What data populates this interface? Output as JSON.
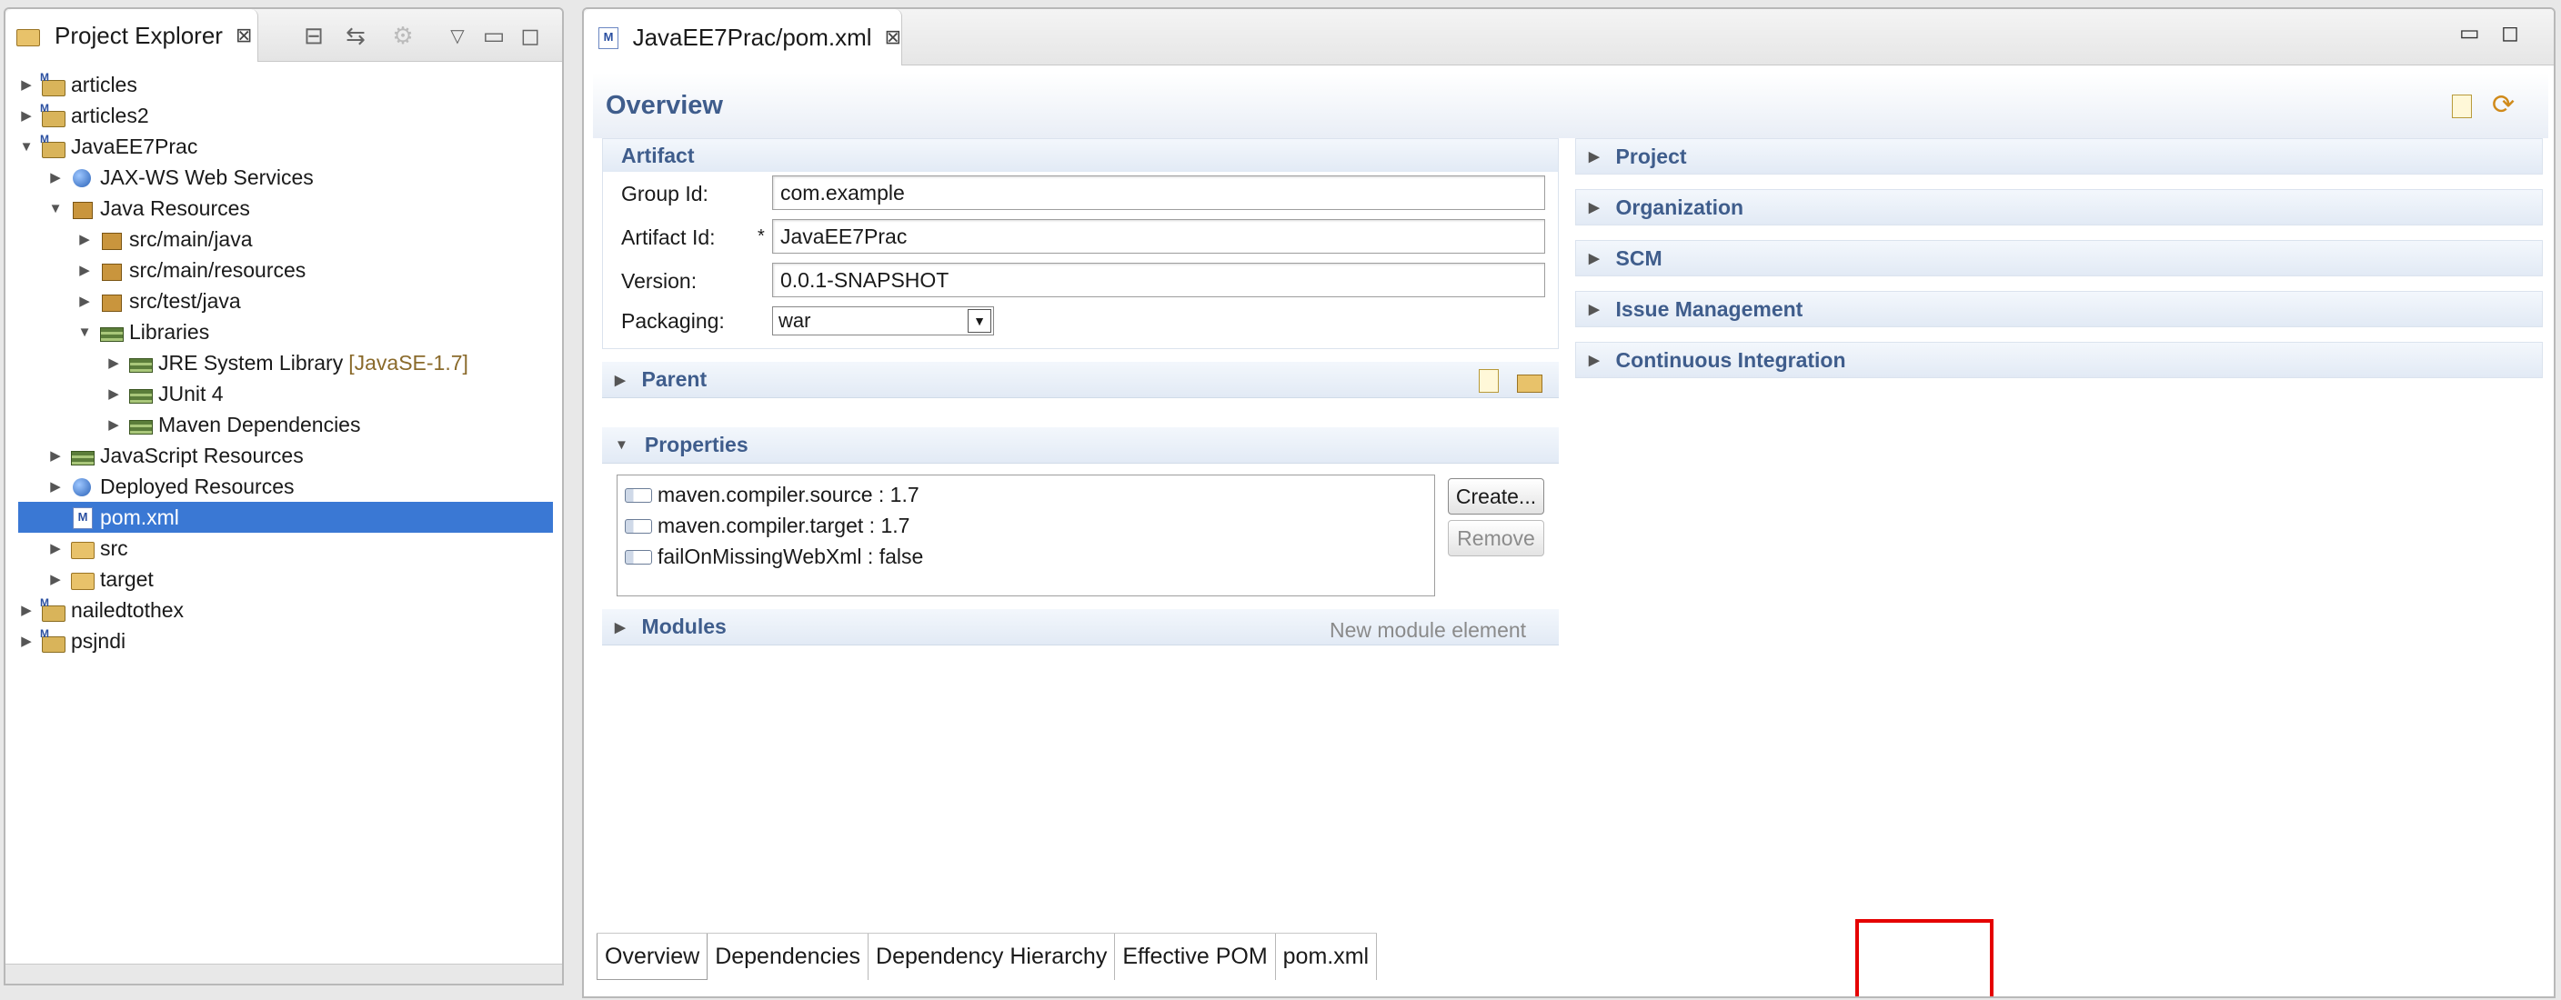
{
  "explorer": {
    "title": "Project Explorer",
    "close_glyph": "⊠",
    "tree": [
      {
        "label": "articles",
        "twisty": "▶",
        "icon": "proj",
        "indent": 0,
        "name": "tree-item-articles"
      },
      {
        "label": "articles2",
        "twisty": "▶",
        "icon": "proj",
        "indent": 0,
        "name": "tree-item-articles2"
      },
      {
        "label": "JavaEE7Prac",
        "twisty": "▼",
        "icon": "proj",
        "indent": 0,
        "name": "tree-item-javaee7prac"
      },
      {
        "label": "JAX-WS Web Services",
        "twisty": "▶",
        "icon": "globe",
        "indent": 1,
        "name": "tree-item-jaxws"
      },
      {
        "label": "Java Resources",
        "twisty": "▼",
        "icon": "pkg",
        "indent": 1,
        "name": "tree-item-java-resources"
      },
      {
        "label": "src/main/java",
        "twisty": "▶",
        "icon": "pkg",
        "indent": 2,
        "name": "tree-item-src-main-java"
      },
      {
        "label": "src/main/resources",
        "twisty": "▶",
        "icon": "pkg",
        "indent": 2,
        "name": "tree-item-src-main-resources"
      },
      {
        "label": "src/test/java",
        "twisty": "▶",
        "icon": "pkg",
        "indent": 2,
        "name": "tree-item-src-test-java"
      },
      {
        "label": "Libraries",
        "twisty": "▼",
        "icon": "lib",
        "indent": 2,
        "name": "tree-item-libraries"
      },
      {
        "label": "JRE System Library",
        "deco": "[JavaSE-1.7]",
        "twisty": "▶",
        "icon": "lib",
        "indent": 3,
        "name": "tree-item-jre"
      },
      {
        "label": "JUnit 4",
        "twisty": "▶",
        "icon": "lib",
        "indent": 3,
        "name": "tree-item-junit"
      },
      {
        "label": "Maven Dependencies",
        "twisty": "▶",
        "icon": "lib",
        "indent": 3,
        "name": "tree-item-maven-deps"
      },
      {
        "label": "JavaScript Resources",
        "twisty": "▶",
        "icon": "lib",
        "indent": 1,
        "name": "tree-item-js-resources"
      },
      {
        "label": "Deployed Resources",
        "twisty": "▶",
        "icon": "globe",
        "indent": 1,
        "name": "tree-item-deployed"
      },
      {
        "label": "pom.xml",
        "twisty": "",
        "icon": "mfile",
        "indent": 1,
        "selected": true,
        "name": "tree-item-pom"
      },
      {
        "label": "src",
        "twisty": "▶",
        "icon": "folder",
        "indent": 1,
        "name": "tree-item-src"
      },
      {
        "label": "target",
        "twisty": "▶",
        "icon": "folder",
        "indent": 1,
        "name": "tree-item-target"
      },
      {
        "label": "nailedtothex",
        "twisty": "▶",
        "icon": "proj",
        "indent": 0,
        "name": "tree-item-nailedtothex"
      },
      {
        "label": "psjndi",
        "twisty": "▶",
        "icon": "proj",
        "indent": 0,
        "name": "tree-item-psjndi"
      }
    ]
  },
  "editor": {
    "tab_title": "JavaEE7Prac/pom.xml",
    "close_glyph": "⊠",
    "form_title": "Overview",
    "artifact": {
      "heading": "Artifact",
      "group_label": "Group Id:",
      "group_value": "com.example",
      "artifact_label": "Artifact Id:",
      "required_mark": "*",
      "artifact_value": "JavaEE7Prac",
      "version_label": "Version:",
      "version_value": "0.0.1-SNAPSHOT",
      "packaging_label": "Packaging:",
      "packaging_value": "war"
    },
    "parent": {
      "heading": "Parent"
    },
    "properties": {
      "heading": "Properties",
      "items": [
        "maven.compiler.source : 1.7",
        "maven.compiler.target : 1.7",
        "failOnMissingWebXml : false"
      ],
      "create_label": "Create...",
      "remove_label": "Remove"
    },
    "modules": {
      "heading": "Modules",
      "hint": "New module element"
    },
    "right_sections": [
      "Project",
      "Organization",
      "SCM",
      "Issue Management",
      "Continuous Integration"
    ],
    "page_tabs": [
      "Overview",
      "Dependencies",
      "Dependency Hierarchy",
      "Effective POM",
      "pom.xml"
    ],
    "highlight_color": "#e50000"
  },
  "glyphs": {
    "collapsed": "▶",
    "expanded": "▼",
    "dropdown": "▼",
    "minimize": "▭",
    "maximize": "◻"
  }
}
